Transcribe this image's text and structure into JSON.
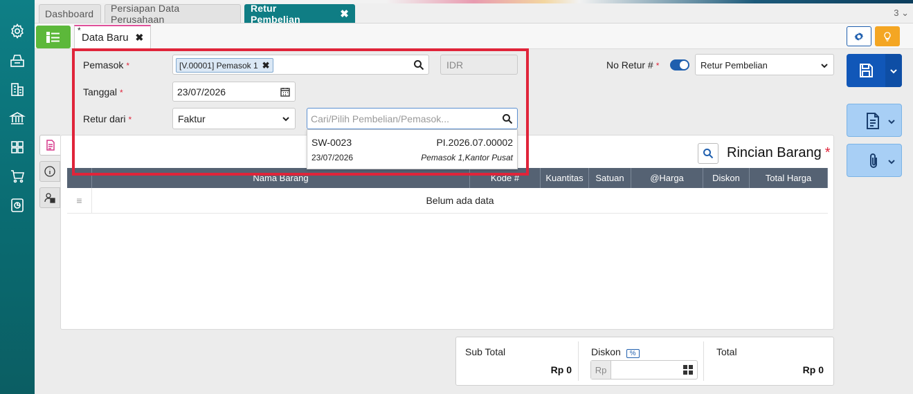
{
  "tabs": [
    {
      "label": "Dashboard"
    },
    {
      "label": "Persiapan Data Perusahaan"
    },
    {
      "label": "Retur Pembelian"
    }
  ],
  "tab_count": "3",
  "subtab": {
    "label": "Data Baru",
    "modified_marker": "*"
  },
  "form": {
    "pemasok_label": "Pemasok",
    "pemasok_chip": "[V.00001] Pemasok 1",
    "currency": "IDR",
    "tanggal_label": "Tanggal",
    "tanggal_value": "23/07/2026",
    "retur_label": "Retur dari",
    "retur_value": "Faktur",
    "search_placeholder": "Cari/Pilih Pembelian/Pemasok...",
    "required_marker": "*"
  },
  "dropdown": {
    "code": "SW-0023",
    "number": "PI.2026.07.00002",
    "date": "23/07/2026",
    "supplier": "Pemasok 1,Kantor Pusat"
  },
  "header_right": {
    "no_retur_label": "No Retur #",
    "type_value": "Retur Pembelian"
  },
  "detail": {
    "title": "Rincian Barang",
    "columns": [
      "Nama Barang",
      "Kode #",
      "Kuantitas",
      "Satuan",
      "@Harga",
      "Diskon",
      "Total Harga"
    ],
    "empty_text": "Belum ada data"
  },
  "totals": {
    "subtotal_label": "Sub Total",
    "subtotal_value": "Rp 0",
    "diskon_label": "Diskon",
    "diskon_badge": "%",
    "diskon_prefix": "Rp",
    "total_label": "Total",
    "total_value": "Rp 0"
  },
  "colors": {
    "sidebar": "#0e7f86",
    "active_tab": "#0f7d84",
    "primary": "#1157b8",
    "highlight": "#e0243a",
    "menu_green": "#5cb83a"
  }
}
